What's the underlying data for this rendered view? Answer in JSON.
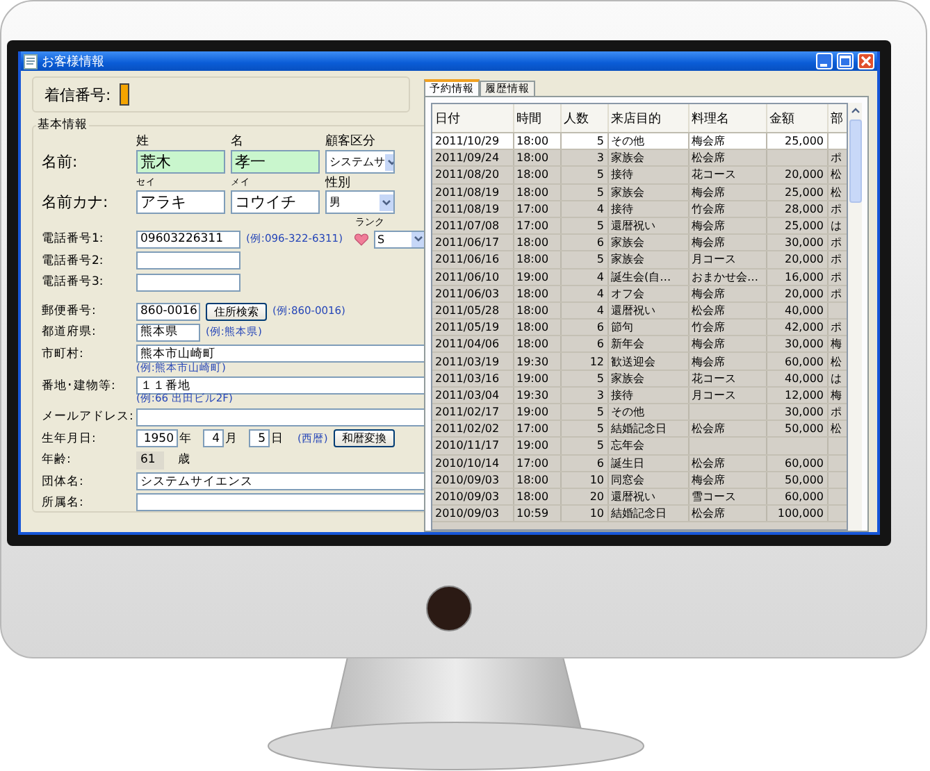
{
  "window": {
    "title": "お客様情報"
  },
  "customer": {
    "incoming_label": "着信番号:",
    "legend": "基本情報",
    "surname_header": "姓",
    "given_header": "名",
    "category_label": "顧客区分",
    "name_label": "名前:",
    "surname": "荒木",
    "given_name": "孝一",
    "category": "システムサ",
    "kana_surname_header": "セイ",
    "kana_given_header": "メイ",
    "gender_label": "性別",
    "kana_label": "名前カナ:",
    "kana_surname": "アラキ",
    "kana_given": "コウイチ",
    "gender": "男",
    "rank_label": "ランク",
    "rank": "S",
    "phones": [
      {
        "label": "電話番号1:",
        "value": "09603226311",
        "hint": "(例:096-322-6311)"
      },
      {
        "label": "電話番号2:"
      },
      {
        "label": "電話番号3:"
      }
    ],
    "postal": {
      "label": "郵便番号:",
      "value": "860-0016",
      "button": "住所検索",
      "hint": "(例:860-0016)"
    },
    "prefecture": {
      "label": "都道府県:",
      "value": "熊本県",
      "hint": "(例:熊本県)"
    },
    "city": {
      "label": "市町村:",
      "value": "熊本市山崎町",
      "hint": "(例:熊本市山崎町)"
    },
    "address": {
      "label": "番地･建物等:",
      "value": "１１番地",
      "hint": "(例:66 出田ビル2F)"
    },
    "email": {
      "label": "メールアドレス:"
    },
    "birthday": {
      "label": "生年月日:",
      "year": "1950",
      "year_unit": "年",
      "month": "4",
      "month_unit": "月",
      "day": "5",
      "day_unit": "日",
      "era": "(西暦)",
      "button": "和暦変換"
    },
    "age": {
      "label": "年齢:",
      "value": "61",
      "unit": "歳"
    },
    "organization": {
      "label": "団体名:",
      "value": "システムサイエンス"
    },
    "department": {
      "label": "所属名:"
    }
  },
  "tabs": [
    {
      "label": "予約情報",
      "selected": true
    },
    {
      "label": "履歴情報",
      "selected": false
    }
  ],
  "table": {
    "columns": [
      "日付",
      "時間",
      "人数",
      "来店目的",
      "料理名",
      "金額",
      "部"
    ],
    "rows": [
      {
        "selected": true,
        "cells": [
          "2011/10/29",
          "18:00",
          "5",
          "その他",
          "梅会席",
          "25,000",
          null
        ]
      },
      {
        "selected": false,
        "cells": [
          "2011/09/24",
          "18:00",
          "3",
          "家族会",
          "松会席",
          null,
          "ポ"
        ]
      },
      {
        "selected": false,
        "cells": [
          "2011/08/20",
          "18:00",
          "5",
          "接待",
          "花コース",
          "20,000",
          "松"
        ]
      },
      {
        "selected": false,
        "cells": [
          "2011/08/19",
          "18:00",
          "5",
          "家族会",
          "梅会席",
          "25,000",
          "松"
        ]
      },
      {
        "selected": false,
        "cells": [
          "2011/08/19",
          "17:00",
          "4",
          "接待",
          "竹会席",
          "28,000",
          "ポ"
        ]
      },
      {
        "selected": false,
        "cells": [
          "2011/07/08",
          "17:00",
          "5",
          "還暦祝い",
          "梅会席",
          "25,000",
          "は"
        ]
      },
      {
        "selected": false,
        "cells": [
          "2011/06/17",
          "18:00",
          "6",
          "家族会",
          "梅会席",
          "30,000",
          "ポ"
        ]
      },
      {
        "selected": false,
        "cells": [
          "2011/06/16",
          "18:00",
          "5",
          "家族会",
          "月コース",
          "20,000",
          "ポ"
        ]
      },
      {
        "selected": false,
        "cells": [
          "2011/06/10",
          "19:00",
          "4",
          "誕生会(自…",
          "おまかせ会…",
          "16,000",
          "ポ"
        ]
      },
      {
        "selected": false,
        "cells": [
          "2011/06/03",
          "18:00",
          "4",
          "オフ会",
          "梅会席",
          "20,000",
          "ポ"
        ]
      },
      {
        "selected": false,
        "cells": [
          "2011/05/28",
          "18:00",
          "4",
          "還暦祝い",
          "松会席",
          "40,000",
          null
        ]
      },
      {
        "selected": false,
        "cells": [
          "2011/05/19",
          "18:00",
          "6",
          "節句",
          "竹会席",
          "42,000",
          "ポ"
        ]
      },
      {
        "selected": false,
        "cells": [
          "2011/04/06",
          "18:00",
          "6",
          "新年会",
          "梅会席",
          "30,000",
          "梅"
        ]
      },
      {
        "selected": false,
        "cells": [
          "2011/03/19",
          "19:30",
          "12",
          "歓送迎会",
          "梅会席",
          "60,000",
          "松"
        ]
      },
      {
        "selected": false,
        "cells": [
          "2011/03/16",
          "19:00",
          "5",
          "家族会",
          "花コース",
          "40,000",
          "は"
        ]
      },
      {
        "selected": false,
        "cells": [
          "2011/03/04",
          "19:30",
          "3",
          "接待",
          "月コース",
          "12,000",
          "梅"
        ]
      },
      {
        "selected": false,
        "cells": [
          "2011/02/17",
          "19:00",
          "5",
          "その他",
          null,
          "30,000",
          "ポ"
        ]
      },
      {
        "selected": false,
        "cells": [
          "2011/02/02",
          "17:00",
          "5",
          "結婚記念日",
          "松会席",
          "50,000",
          "松"
        ]
      },
      {
        "selected": false,
        "cells": [
          "2010/11/17",
          "19:00",
          "5",
          "忘年会",
          null,
          null,
          null
        ]
      },
      {
        "selected": false,
        "cells": [
          "2010/10/14",
          "17:00",
          "6",
          "誕生日",
          "松会席",
          "60,000",
          null
        ]
      },
      {
        "selected": false,
        "cells": [
          "2010/09/03",
          "18:00",
          "10",
          "同窓会",
          "梅会席",
          "50,000",
          null
        ]
      },
      {
        "selected": false,
        "cells": [
          "2010/09/03",
          "18:00",
          "20",
          "還暦祝い",
          "雪コース",
          "60,000",
          null
        ]
      },
      {
        "selected": false,
        "cells": [
          "2010/09/03",
          "10:59",
          "10",
          "結婚記念日",
          "松会席",
          "100,000",
          null
        ]
      }
    ]
  }
}
